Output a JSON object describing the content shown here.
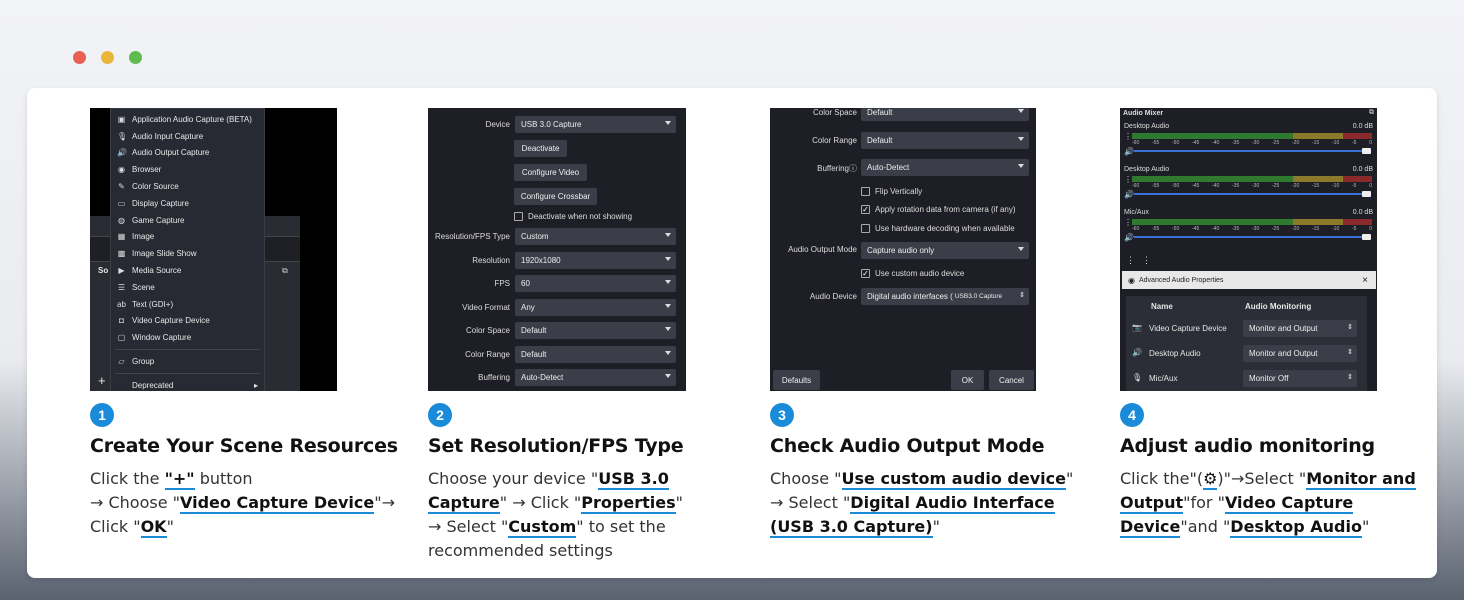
{
  "colors": {
    "dot_red": "#e95f55",
    "dot_yellow": "#e9b53a",
    "dot_green": "#5fbb4d",
    "accent": "#1a8bd9"
  },
  "steps": [
    {
      "number": "1",
      "title": "Create Your Scene Resources",
      "desc": {
        "p1": "Click the ",
        "h1": "\"+\"",
        "p2": " button",
        "p3": "→ Choose \"",
        "h2": "Video Capture Device",
        "p4": "\"→ Click \"",
        "h3": "OK",
        "p5": "\""
      }
    },
    {
      "number": "2",
      "title": "Set Resolution/FPS Type",
      "desc": {
        "p1": "Choose your device \"",
        "h1": "USB 3.0 Capture",
        "p2": "\" → Click \"",
        "h2": "Properties",
        "p3": "\"",
        "p4": "→ Select \"",
        "h3": "Custom",
        "p5": "\" to set the recommended settings"
      }
    },
    {
      "number": "3",
      "title": "Check Audio Output Mode",
      "desc": {
        "p1": "Choose \"",
        "h1": "Use custom audio device",
        "p2": "\"",
        "p3": "→ Select \"",
        "h2": "Digital Audio Interface (USB 3.0 Capture)",
        "p4": "\""
      }
    },
    {
      "number": "4",
      "title": "Adjust audio monitoring",
      "desc": {
        "p1": "Click the\"(",
        "h1": "⚙",
        "p2": ")\"→Select \"",
        "h2": "Monitor and Output",
        "p3": "\"for \"",
        "h3": "Video Capture Device",
        "p4": "\"and \"",
        "h4": "Desktop Audio",
        "p5": "\""
      }
    }
  ],
  "shot1": {
    "menu_items": [
      {
        "icon": "▣",
        "label": "Application Audio Capture (BETA)"
      },
      {
        "icon": "🎙",
        "label": "Audio Input Capture"
      },
      {
        "icon": "🔊",
        "label": "Audio Output Capture"
      },
      {
        "icon": "◉",
        "label": "Browser"
      },
      {
        "icon": "✎",
        "label": "Color Source"
      },
      {
        "icon": "▭",
        "label": "Display Capture"
      },
      {
        "icon": "◍",
        "label": "Game Capture"
      },
      {
        "icon": "▦",
        "label": "Image"
      },
      {
        "icon": "▩",
        "label": "Image Slide Show"
      },
      {
        "icon": "▶",
        "label": "Media Source"
      },
      {
        "icon": "☰",
        "label": "Scene"
      },
      {
        "icon": "ab",
        "label": "Text (GDI+)"
      },
      {
        "icon": "◘",
        "label": "Video Capture Device"
      },
      {
        "icon": "▢",
        "label": "Window Capture"
      }
    ],
    "group_label": "Group",
    "deprecated_label": "Deprecated",
    "so_label": "So",
    "plus_label": "+"
  },
  "shot2": {
    "device_label": "Device",
    "device_value": "USB 3.0 Capture",
    "deactivate": "Deactivate",
    "configure_video": "Configure Video",
    "configure_crossbar": "Configure Crossbar",
    "deactivate_chk": "Deactivate when not showing",
    "rows": [
      {
        "label": "Resolution/FPS Type",
        "value": "Custom"
      },
      {
        "label": "Resolution",
        "value": "1920x1080"
      },
      {
        "label": "FPS",
        "value": "60"
      },
      {
        "label": "Video Format",
        "value": "Any"
      },
      {
        "label": "Color Space",
        "value": "Default"
      },
      {
        "label": "Color Range",
        "value": "Default"
      },
      {
        "label": "Buffering",
        "value": "Auto-Detect"
      }
    ]
  },
  "shot3": {
    "color_space": "Color Space",
    "color_space_value": "Default",
    "color_range": "Color Range",
    "color_range_value": "Default",
    "buffering": "Buffering",
    "buffering_value": "Auto-Detect",
    "flip": "Flip Vertically",
    "rotation": "Apply rotation data from camera (if any)",
    "hwdecode": "Use hardware decoding when available",
    "audio_mode_label": "Audio Output Mode",
    "audio_mode_value": "Capture audio only",
    "custom_audio": "Use custom audio device",
    "audio_device_label": "Audio Device",
    "audio_device_value": "Digital audio interfaces (",
    "audio_device_value_small": "USB3.0 Capture",
    "defaults": "Defaults",
    "ok": "OK",
    "cancel": "Cancel"
  },
  "shot4": {
    "mixer_title": "Audio Mixer",
    "channels": [
      {
        "name": "Desktop Audio",
        "db": "0.0 dB"
      },
      {
        "name": "Desktop Audio",
        "db": "0.0 dB"
      },
      {
        "name": "Mic/Aux",
        "db": "0.0 dB"
      }
    ],
    "scale_ticks": [
      "-60",
      "-55",
      "-50",
      "-45",
      "-40",
      "-35",
      "-30",
      "-25",
      "-20",
      "-15",
      "-10",
      "-5",
      "0"
    ],
    "adv_title": "Advanced Audio Properties",
    "col_name": "Name",
    "col_monitoring": "Audio Monitoring",
    "rows": [
      {
        "name": "Video Capture Device",
        "value": "Monitor and Output"
      },
      {
        "name": "Desktop Audio",
        "value": "Monitor and Output"
      },
      {
        "name": "Mic/Aux",
        "value": "Monitor Off"
      }
    ]
  }
}
